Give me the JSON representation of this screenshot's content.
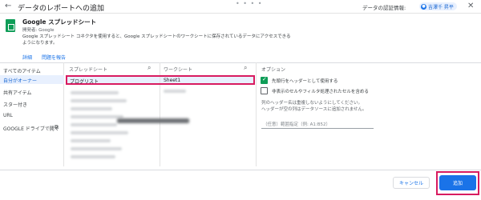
{
  "header": {
    "title": "データのレポートへの追加",
    "back_icon": "←",
    "drag_handle": "• • • •",
    "credentials_label": "データの認証情報:",
    "credentials_user": "吉澤千 昇平",
    "close_icon": "✕"
  },
  "connector": {
    "name": "Google スプレッドシート",
    "developer": "開発者: Google",
    "description": "Google スプレッドシート コネクタを使用すると、Google スプレッドシートのワークシートに保存されているデータにアクセスできるようになります。",
    "link_details": "詳細",
    "link_report": "問題を報告"
  },
  "sidebar": {
    "items": [
      "すべてのアイテム",
      "自分がオーナー",
      "共有アイテム",
      "スター付き",
      "URL",
      "GOOGLE ドライブで開く"
    ],
    "selected_index": 1
  },
  "columns": {
    "spreadsheet_header": "スプレッドシート",
    "worksheet_header": "ワークシート",
    "options_header": "オプション"
  },
  "selected_row": {
    "spreadsheet": "プログリスト",
    "worksheet": "Sheet1"
  },
  "options": {
    "use_header": "先頭行をヘッダーとして使用する",
    "use_header_checked": true,
    "include_hidden": "非表示のセルやフィルタ処理されたセルを含める",
    "include_hidden_checked": false,
    "note_1": "列のヘッダー名は重複しないようにしてください。",
    "note_2": "ヘッダーが空の列はデータソースに追加されません。",
    "range_placeholder": "（任意）範囲指定（例: A1:B52）"
  },
  "footer": {
    "cancel_label": "キャンセル",
    "add_label": "追加"
  },
  "colors": {
    "accent": "#1a73e8",
    "highlight": "#d81b60",
    "sheets_green": "#0f9d58"
  }
}
